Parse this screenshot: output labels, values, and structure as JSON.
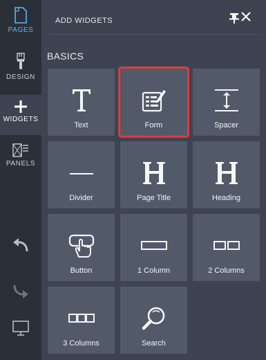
{
  "rail": {
    "pages_label": "PAGES",
    "design_label": "DESIGN",
    "widgets_label": "WIDGETS",
    "panels_label": "PANELS"
  },
  "panel": {
    "title": "ADD WIDGETS",
    "section": "BASICS",
    "selected_widget": "Form",
    "widgets": [
      {
        "label": "Text",
        "icon": "text-icon"
      },
      {
        "label": "Form",
        "icon": "form-icon"
      },
      {
        "label": "Spacer",
        "icon": "spacer-icon"
      },
      {
        "label": "Divider",
        "icon": "divider-icon"
      },
      {
        "label": "Page Title",
        "icon": "page-title-icon"
      },
      {
        "label": "Heading",
        "icon": "heading-icon"
      },
      {
        "label": "Button",
        "icon": "button-icon"
      },
      {
        "label": "1 Column",
        "icon": "one-column-icon"
      },
      {
        "label": "2 Columns",
        "icon": "two-columns-icon"
      },
      {
        "label": "3 Columns",
        "icon": "three-columns-icon"
      },
      {
        "label": "Search",
        "icon": "search-icon"
      }
    ]
  },
  "colors": {
    "rail_bg": "#2b2f37",
    "panel_bg": "#3d4350",
    "tile_bg": "#525a69",
    "accent_blue": "#5fb6f2",
    "selection_red": "#e0393e"
  }
}
